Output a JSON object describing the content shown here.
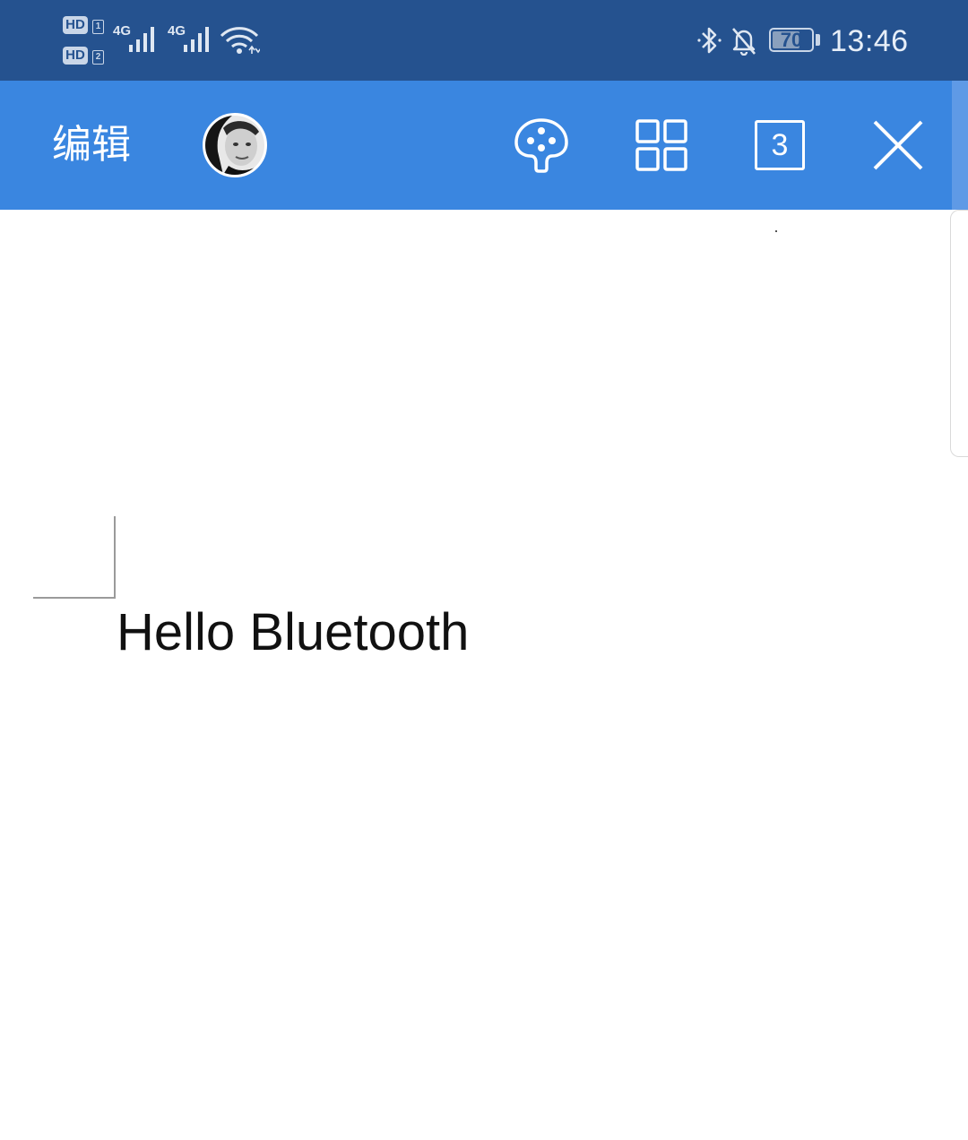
{
  "status_bar": {
    "sim1": {
      "badge": "HD",
      "slot": "1"
    },
    "sim2": {
      "badge": "HD",
      "slot": "2"
    },
    "signal1_network": "4G",
    "signal2_network": "4G",
    "battery_level": "70",
    "time": "13:46",
    "icons": [
      "wifi-icon",
      "bluetooth-icon",
      "bell-off-icon"
    ]
  },
  "toolbar": {
    "edit_label": "编辑",
    "avatar_icon": "avatar",
    "palette_icon": "palette-icon",
    "grid_icon": "grid-icon",
    "count": "3",
    "close_icon": "close-icon",
    "background_color": "#3a86e0"
  },
  "document": {
    "text": "Hello Bluetooth"
  },
  "colors": {
    "status_bar": "#25528f",
    "toolbar": "#3a86e0",
    "text": "#111111"
  }
}
